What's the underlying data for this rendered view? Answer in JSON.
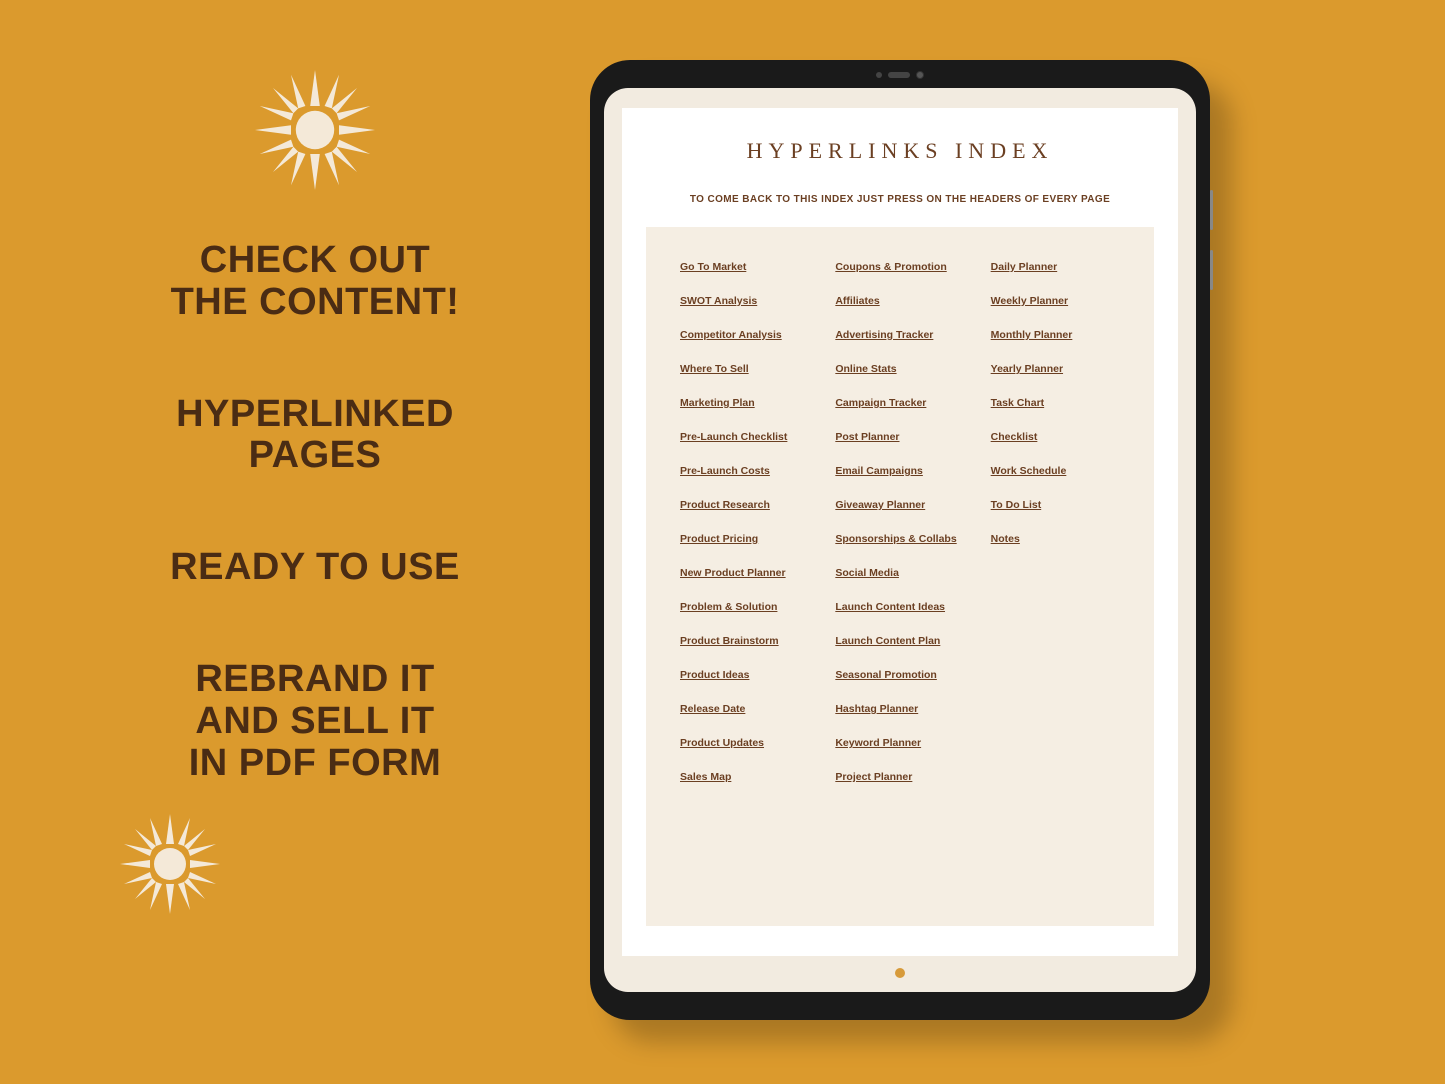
{
  "left": {
    "block1_l1": "CHECK OUT",
    "block1_l2": "THE CONTENT!",
    "block2_l1": "HYPERLINKED",
    "block2_l2": "PAGES",
    "block3_l1": "READY TO USE",
    "block4_l1": "REBRAND IT",
    "block4_l2": "AND SELL IT",
    "block4_l3": "IN PDF FORM"
  },
  "tablet": {
    "title": "HYPERLINKS INDEX",
    "subtitle": "TO COME BACK TO THIS INDEX JUST PRESS ON THE HEADERS OF EVERY PAGE",
    "col1": [
      "Go To Market",
      "SWOT Analysis",
      "Competitor Analysis",
      "Where To Sell",
      "Marketing Plan",
      "Pre-Launch Checklist",
      "Pre-Launch Costs",
      "Product Research",
      "Product Pricing",
      "New Product Planner",
      "Problem & Solution",
      "Product Brainstorm",
      "Product Ideas",
      "Release Date",
      "Product Updates",
      "Sales Map"
    ],
    "col2": [
      "Coupons & Promotion",
      "Affiliates",
      "Advertising Tracker",
      "Online Stats",
      "Campaign Tracker",
      "Post Planner",
      "Email Campaigns",
      "Giveaway Planner",
      "Sponsorships & Collabs",
      "Social Media",
      "Launch Content Ideas",
      "Launch Content Plan",
      "Seasonal Promotion",
      "Hashtag Planner",
      "Keyword Planner",
      "Project Planner"
    ],
    "col3": [
      "Daily Planner",
      "Weekly Planner",
      "Monthly Planner",
      "Yearly Planner",
      "Task Chart",
      "Checklist",
      "Work Schedule",
      "To Do List",
      "Notes"
    ]
  }
}
